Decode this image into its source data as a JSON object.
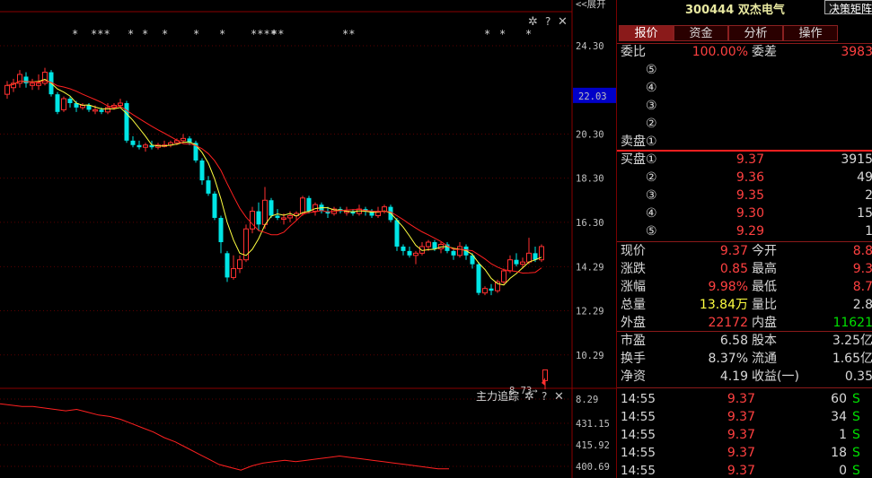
{
  "chart_data": {
    "type": "candlestick",
    "y_ticks": [
      "24.30",
      "22.03",
      "20.30",
      "18.30",
      "16.30",
      "14.29",
      "12.29",
      "10.29",
      "8.29"
    ],
    "current_price_tag": "22.03",
    "low_marker_label": "8.73",
    "top_link": "<<展开",
    "star_marks": [
      "*",
      "***",
      "*",
      "*",
      "*",
      "*",
      "*",
      "****",
      "**",
      "**",
      "*",
      "*",
      "*",
      "*"
    ],
    "candles": [
      {
        "o": 22.1,
        "c": 22.5,
        "h": 22.7,
        "l": 21.9
      },
      {
        "o": 22.4,
        "c": 22.6,
        "h": 22.8,
        "l": 22.2
      },
      {
        "o": 22.6,
        "c": 23.0,
        "h": 23.2,
        "l": 22.4
      },
      {
        "o": 22.9,
        "c": 22.6,
        "h": 23.1,
        "l": 22.4
      },
      {
        "o": 22.5,
        "c": 22.6,
        "h": 22.8,
        "l": 22.3
      },
      {
        "o": 22.5,
        "c": 22.6,
        "h": 23.0,
        "l": 22.3
      },
      {
        "o": 22.6,
        "c": 23.1,
        "h": 23.3,
        "l": 22.5
      },
      {
        "o": 23.1,
        "c": 22.1,
        "h": 23.2,
        "l": 22.0
      },
      {
        "o": 22.1,
        "c": 21.3,
        "h": 22.2,
        "l": 21.2
      },
      {
        "o": 21.4,
        "c": 21.9,
        "h": 22.0,
        "l": 21.3
      },
      {
        "o": 21.9,
        "c": 21.7,
        "h": 22.0,
        "l": 21.5
      },
      {
        "o": 21.7,
        "c": 21.5,
        "h": 21.8,
        "l": 21.3
      },
      {
        "o": 21.5,
        "c": 21.6,
        "h": 21.7,
        "l": 21.4
      },
      {
        "o": 21.6,
        "c": 21.4,
        "h": 21.7,
        "l": 21.3
      },
      {
        "o": 21.4,
        "c": 21.4,
        "h": 21.6,
        "l": 21.2
      },
      {
        "o": 21.4,
        "c": 21.3,
        "h": 21.5,
        "l": 21.2
      },
      {
        "o": 21.3,
        "c": 21.5,
        "h": 21.7,
        "l": 21.2
      },
      {
        "o": 21.5,
        "c": 21.6,
        "h": 21.7,
        "l": 21.4
      },
      {
        "o": 21.6,
        "c": 21.7,
        "h": 21.9,
        "l": 21.5
      },
      {
        "o": 21.7,
        "c": 20.0,
        "h": 21.8,
        "l": 19.9
      },
      {
        "o": 20.0,
        "c": 19.8,
        "h": 20.2,
        "l": 19.7
      },
      {
        "o": 19.8,
        "c": 19.7,
        "h": 20.0,
        "l": 19.6
      },
      {
        "o": 19.7,
        "c": 19.8,
        "h": 19.9,
        "l": 19.5
      },
      {
        "o": 19.8,
        "c": 19.7,
        "h": 20.0,
        "l": 19.6
      },
      {
        "o": 19.7,
        "c": 19.8,
        "h": 19.9,
        "l": 19.6
      },
      {
        "o": 19.8,
        "c": 19.8,
        "h": 20.0,
        "l": 19.7
      },
      {
        "o": 19.8,
        "c": 19.9,
        "h": 20.0,
        "l": 19.7
      },
      {
        "o": 19.9,
        "c": 20.0,
        "h": 20.1,
        "l": 19.8
      },
      {
        "o": 20.0,
        "c": 20.1,
        "h": 20.3,
        "l": 19.9
      },
      {
        "o": 20.1,
        "c": 19.9,
        "h": 20.2,
        "l": 19.8
      },
      {
        "o": 19.9,
        "c": 19.1,
        "h": 20.0,
        "l": 19.0
      },
      {
        "o": 19.1,
        "c": 18.2,
        "h": 19.2,
        "l": 18.0
      },
      {
        "o": 18.2,
        "c": 17.6,
        "h": 18.4,
        "l": 17.5
      },
      {
        "o": 17.6,
        "c": 16.5,
        "h": 17.7,
        "l": 16.4
      },
      {
        "o": 16.5,
        "c": 15.4,
        "h": 16.6,
        "l": 14.9
      },
      {
        "o": 14.9,
        "c": 13.8,
        "h": 15.0,
        "l": 13.6
      },
      {
        "o": 13.8,
        "c": 14.2,
        "h": 14.8,
        "l": 13.7
      },
      {
        "o": 14.2,
        "c": 14.6,
        "h": 14.8,
        "l": 14.0
      },
      {
        "o": 14.6,
        "c": 16.0,
        "h": 16.2,
        "l": 14.5
      },
      {
        "o": 16.0,
        "c": 16.8,
        "h": 17.0,
        "l": 15.8
      },
      {
        "o": 16.8,
        "c": 16.2,
        "h": 17.2,
        "l": 15.9
      },
      {
        "o": 16.2,
        "c": 17.3,
        "h": 17.9,
        "l": 16.0
      },
      {
        "o": 17.3,
        "c": 16.6,
        "h": 17.4,
        "l": 16.5
      },
      {
        "o": 16.6,
        "c": 16.5,
        "h": 16.9,
        "l": 16.4
      },
      {
        "o": 16.5,
        "c": 16.5,
        "h": 16.7,
        "l": 16.2
      },
      {
        "o": 16.5,
        "c": 16.6,
        "h": 16.8,
        "l": 16.3
      },
      {
        "o": 16.6,
        "c": 16.7,
        "h": 16.8,
        "l": 16.4
      },
      {
        "o": 16.7,
        "c": 17.4,
        "h": 17.5,
        "l": 16.6
      },
      {
        "o": 17.4,
        "c": 16.8,
        "h": 17.5,
        "l": 16.7
      },
      {
        "o": 16.8,
        "c": 17.1,
        "h": 17.2,
        "l": 16.6
      },
      {
        "o": 17.1,
        "c": 16.8,
        "h": 17.2,
        "l": 16.7
      },
      {
        "o": 16.8,
        "c": 16.7,
        "h": 17.0,
        "l": 16.5
      },
      {
        "o": 16.7,
        "c": 16.9,
        "h": 17.0,
        "l": 16.6
      },
      {
        "o": 16.9,
        "c": 16.8,
        "h": 17.0,
        "l": 16.7
      },
      {
        "o": 16.8,
        "c": 16.8,
        "h": 17.0,
        "l": 16.6
      },
      {
        "o": 16.8,
        "c": 16.7,
        "h": 16.9,
        "l": 16.6
      },
      {
        "o": 16.7,
        "c": 16.9,
        "h": 17.1,
        "l": 16.6
      },
      {
        "o": 16.9,
        "c": 16.8,
        "h": 17.0,
        "l": 16.6
      },
      {
        "o": 16.8,
        "c": 16.6,
        "h": 16.9,
        "l": 16.5
      },
      {
        "o": 16.6,
        "c": 16.8,
        "h": 17.0,
        "l": 16.5
      },
      {
        "o": 16.8,
        "c": 17.0,
        "h": 17.1,
        "l": 16.7
      },
      {
        "o": 17.0,
        "c": 16.4,
        "h": 17.1,
        "l": 16.3
      },
      {
        "o": 16.4,
        "c": 15.2,
        "h": 16.5,
        "l": 15.0
      },
      {
        "o": 15.2,
        "c": 15.0,
        "h": 15.3,
        "l": 14.8
      },
      {
        "o": 15.0,
        "c": 14.8,
        "h": 15.2,
        "l": 14.7
      },
      {
        "o": 14.8,
        "c": 14.9,
        "h": 15.0,
        "l": 14.4
      },
      {
        "o": 14.9,
        "c": 15.2,
        "h": 15.4,
        "l": 14.8
      },
      {
        "o": 15.2,
        "c": 15.4,
        "h": 15.5,
        "l": 15.0
      },
      {
        "o": 15.4,
        "c": 15.1,
        "h": 15.5,
        "l": 15.0
      },
      {
        "o": 15.1,
        "c": 15.3,
        "h": 15.4,
        "l": 14.9
      },
      {
        "o": 15.3,
        "c": 15.0,
        "h": 15.4,
        "l": 14.9
      },
      {
        "o": 15.0,
        "c": 14.8,
        "h": 15.1,
        "l": 14.6
      },
      {
        "o": 14.8,
        "c": 15.2,
        "h": 15.4,
        "l": 14.7
      },
      {
        "o": 15.2,
        "c": 14.8,
        "h": 15.3,
        "l": 14.6
      },
      {
        "o": 14.8,
        "c": 14.4,
        "h": 14.9,
        "l": 14.2
      },
      {
        "o": 14.4,
        "c": 13.1,
        "h": 14.5,
        "l": 13.0
      },
      {
        "o": 13.1,
        "c": 13.3,
        "h": 13.4,
        "l": 13.0
      },
      {
        "o": 13.3,
        "c": 13.2,
        "h": 13.5,
        "l": 13.0
      },
      {
        "o": 13.2,
        "c": 13.6,
        "h": 13.7,
        "l": 13.1
      },
      {
        "o": 13.6,
        "c": 14.1,
        "h": 14.2,
        "l": 13.5
      },
      {
        "o": 14.1,
        "c": 14.6,
        "h": 14.8,
        "l": 14.0
      },
      {
        "o": 14.6,
        "c": 14.4,
        "h": 14.9,
        "l": 14.3
      },
      {
        "o": 14.4,
        "c": 14.5,
        "h": 14.7,
        "l": 14.2
      },
      {
        "o": 14.5,
        "c": 14.9,
        "h": 15.6,
        "l": 14.4
      },
      {
        "o": 14.9,
        "c": 14.6,
        "h": 15.2,
        "l": 14.5
      },
      {
        "o": 14.6,
        "c": 15.2,
        "h": 15.3,
        "l": 14.5
      },
      {
        "o": 8.8,
        "c": 9.37,
        "h": 9.37,
        "l": 8.73
      }
    ],
    "indicator": {
      "title": "主力追踪",
      "y_ticks": [
        "431.15",
        "415.92",
        "400.69"
      ],
      "line": [
        445,
        444,
        443,
        443,
        442,
        441,
        440,
        441,
        439,
        437,
        436,
        434,
        431,
        428,
        425,
        421,
        418,
        414,
        410,
        406,
        402,
        400,
        398,
        401,
        403,
        404,
        405,
        404,
        405,
        406,
        407,
        408,
        407,
        406,
        405,
        404,
        403,
        402,
        401,
        400,
        399,
        399
      ]
    }
  },
  "panel": {
    "code": "300444",
    "name": "双杰电气",
    "header_button": "决策矩阵",
    "tabs": [
      "报价",
      "资金",
      "分析",
      "操作"
    ],
    "weibi_label": "委比",
    "weibi_value": "100.00%",
    "weicha_label": "委差",
    "weicha_value": "3983",
    "sell_label": "卖盘",
    "buy_label": "买盘",
    "sell_levels": [
      "⑤",
      "④",
      "③",
      "②",
      "①"
    ],
    "buy_levels": [
      {
        "lvl": "①",
        "price": "9.37",
        "vol": "3915"
      },
      {
        "lvl": "②",
        "price": "9.36",
        "vol": "49"
      },
      {
        "lvl": "③",
        "price": "9.35",
        "vol": "2"
      },
      {
        "lvl": "④",
        "price": "9.30",
        "vol": "15"
      },
      {
        "lvl": "⑤",
        "price": "9.29",
        "vol": "1"
      }
    ],
    "quote": [
      {
        "l1": "现价",
        "v1": "9.37",
        "c1": "red",
        "l2": "今开",
        "v2": "8.8",
        "c2": "red"
      },
      {
        "l1": "涨跌",
        "v1": "0.85",
        "c1": "red",
        "l2": "最高",
        "v2": "9.3",
        "c2": "red"
      },
      {
        "l1": "涨幅",
        "v1": "9.98%",
        "c1": "red",
        "l2": "最低",
        "v2": "8.7",
        "c2": "red"
      },
      {
        "l1": "总量",
        "v1": "13.84万",
        "c1": "yellow",
        "l2": "量比",
        "v2": "2.8",
        "c2": "white"
      },
      {
        "l1": "外盘",
        "v1": "22172",
        "c1": "red",
        "l2": "内盘",
        "v2": "11621",
        "c2": "green"
      }
    ],
    "fund": [
      {
        "l1": "市盈",
        "v1": "6.58",
        "l2": "股本",
        "v2": "3.25亿"
      },
      {
        "l1": "换手",
        "v1": "8.37%",
        "l2": "流通",
        "v2": "1.65亿"
      },
      {
        "l1": "净资",
        "v1": "4.19",
        "l2": "收益(一)",
        "v2": "0.35"
      }
    ],
    "ticks": [
      {
        "t": "14:55",
        "p": "9.37",
        "v": "60",
        "s": "S"
      },
      {
        "t": "14:55",
        "p": "9.37",
        "v": "34",
        "s": "S"
      },
      {
        "t": "14:55",
        "p": "9.37",
        "v": "1",
        "s": "S"
      },
      {
        "t": "14:55",
        "p": "9.37",
        "v": "18",
        "s": "S"
      },
      {
        "t": "14:55",
        "p": "9.37",
        "v": "0",
        "s": "S"
      }
    ]
  }
}
